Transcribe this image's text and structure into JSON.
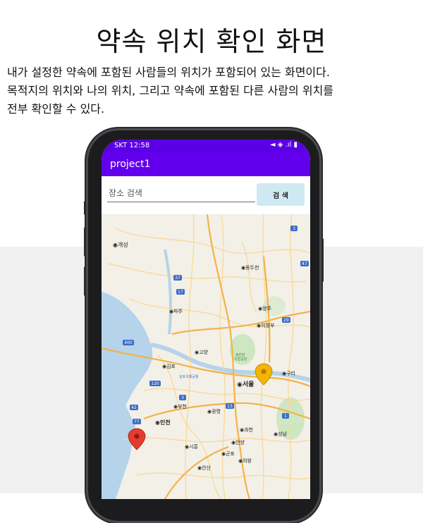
{
  "header": {
    "title": "약속 위치 확인 화면",
    "description": [
      "내가 설정한 약속에 포함된 사람들의 위치가 포함되어 있는 화면이다.",
      "목적지의 위치와 나의 위치, 그리고 약속에 포함된 다른 사람의 위치를",
      "전부 확인할 수 있다."
    ]
  },
  "phone": {
    "status_left": "SKT 12:58",
    "status_right": "◄ ◈ .ıl ▮",
    "app_title": "project1",
    "search": {
      "placeholder": "장소 검색",
      "value": ""
    },
    "search_button": "검 색"
  },
  "map": {
    "labels": {
      "kaesong": "◉개성",
      "dongducheon": "◉동두천",
      "paju": "◉파주",
      "yangju": "◉양주",
      "uijeongbu": "◉의정부",
      "goyang": "◉고양",
      "bukhansan": "북한산",
      "national_park": "국립공원",
      "gimpo": "◉김포",
      "seoul": "◉서울",
      "guri": "◉구리",
      "gimpo_airport": "김포국제공항",
      "bucheon": "◉부천",
      "gwangmyeong": "◉광명",
      "incheon": "◉인천",
      "gwacheon": "◉과천",
      "seongnam": "◉성남",
      "siheung": "◉시흥",
      "anyang": "◉안양",
      "gunpo": "◉군포",
      "uiwang": "◉의왕",
      "ansan": "◉안산"
    },
    "route_badges": [
      "37",
      "17",
      "3",
      "47",
      "29",
      "400",
      "120",
      "42",
      "77",
      "3",
      "13",
      "1"
    ],
    "markers": [
      {
        "name": "destination",
        "color": "#f5b400"
      },
      {
        "name": "my-location",
        "color": "#e53b2c"
      }
    ],
    "colors": {
      "water": "#b5d3ea",
      "land": "#f3f0e8",
      "park": "#cfe6c3",
      "expressway": "#f3b24a",
      "road": "#fbd68e"
    }
  }
}
